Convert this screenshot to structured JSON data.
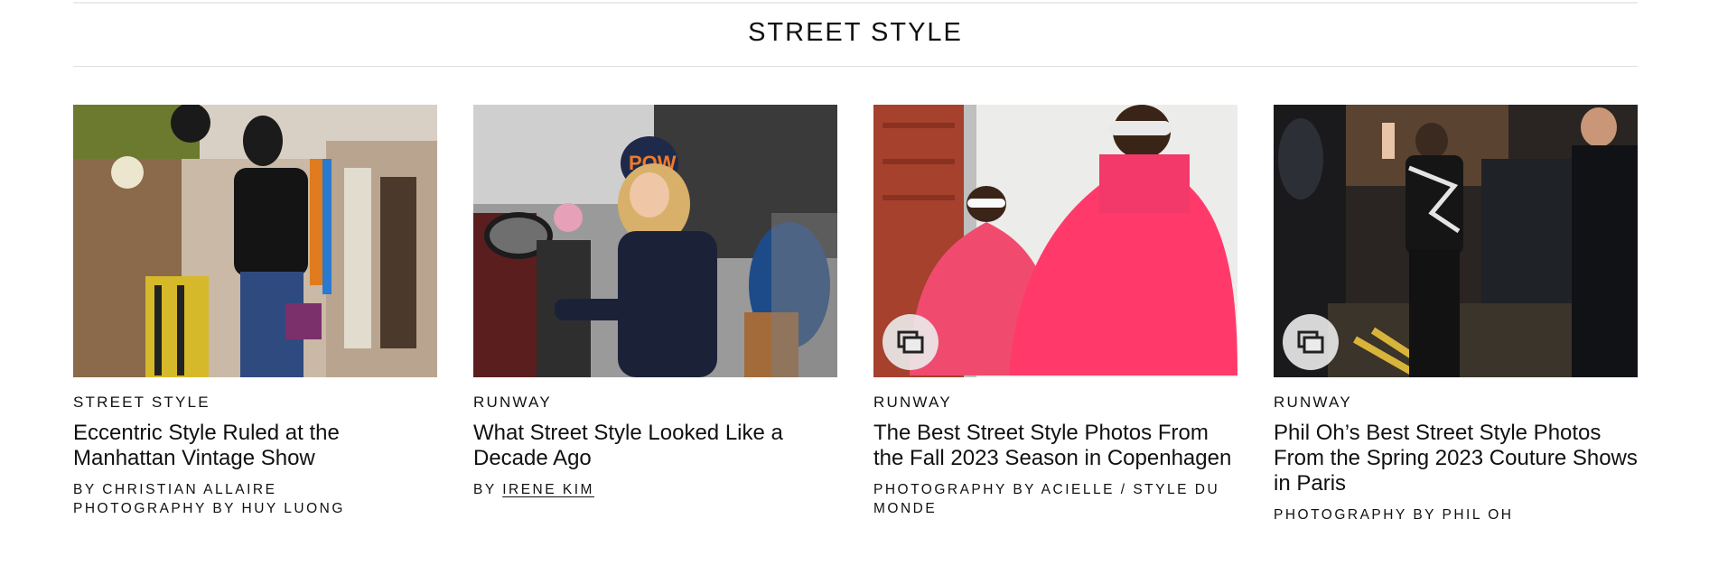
{
  "section": {
    "title": "STREET STYLE"
  },
  "cards": [
    {
      "rubric": "STREET STYLE",
      "headline": "Eccentric Style Ruled at the Manhattan Vintage Show",
      "byline_line1": "BY CHRISTIAN ALLAIRE",
      "byline_line2": "PHOTOGRAPHY BY HUY LUONG",
      "has_gallery_icon": false
    },
    {
      "rubric": "RUNWAY",
      "headline": "What Street Style Looked Like a Decade Ago",
      "byline_prefix": "BY ",
      "byline_author": "IRENE KIM",
      "has_gallery_icon": false
    },
    {
      "rubric": "RUNWAY",
      "headline": "The Best Street Style Photos From the Fall 2023 Season in Copenhagen",
      "byline_line1": "PHOTOGRAPHY BY ACIELLE / STYLE DU MONDE",
      "has_gallery_icon": true
    },
    {
      "rubric": "RUNWAY",
      "headline": "Phil Oh’s Best Street Style Photos From the Spring 2023 Couture Shows in Paris",
      "byline_line1": "PHOTOGRAPHY BY PHIL OH",
      "has_gallery_icon": true
    }
  ],
  "colors": {
    "text": "#111111",
    "rule": "#e0e0e0",
    "badge_bg": "#ebebeb"
  },
  "icons": {
    "gallery": "gallery-icon"
  }
}
